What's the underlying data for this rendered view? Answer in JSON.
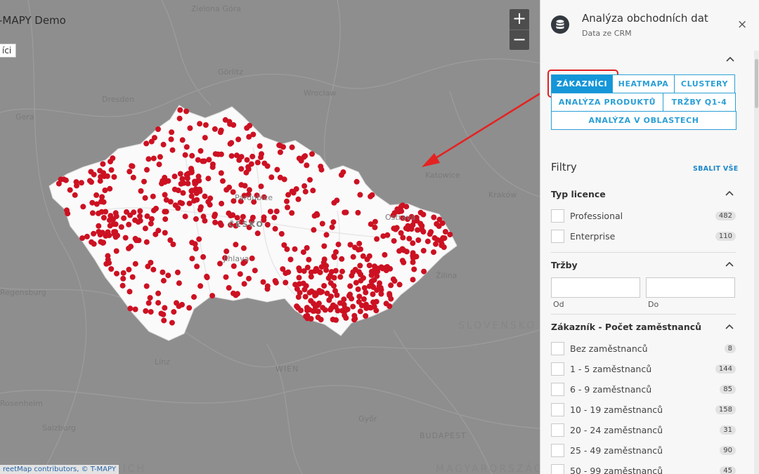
{
  "map": {
    "title": "-MAPY Demo",
    "customers_button": "íci",
    "zoom_in": "+",
    "zoom_out": "−",
    "attribution": "reetMap contributors, © T-MAPY",
    "labels": [
      "Zielona Góra",
      "Dresden",
      "Wrocław",
      "Görlitz",
      "Gera",
      "Katowice",
      "Kraków",
      "Ostrava",
      "Jihlava",
      "ČESKO",
      "Žilina",
      "SLOVENSKO",
      "WIEN",
      "Linz",
      "Salzburg",
      "Győr",
      "BUDAPEST",
      "Rosenheim",
      "MAGYARORSZÁG",
      "REICH",
      "Regensburg",
      "Pardubice"
    ],
    "point_color": "#cc1122"
  },
  "panel": {
    "title": "Analýza obchodních dat",
    "subtitle": "Data ze CRM",
    "close": "×",
    "tabs_row1": [
      "ZÁKAZNÍCI",
      "HEATMAPA",
      "CLUSTERY"
    ],
    "tabs_row2": [
      "ANALÝZA PRODUKTŮ",
      "TRŽBY Q1-4"
    ],
    "tabs_row3": [
      "ANALÝZA V OBLASTECH"
    ],
    "filters_title": "Filtry",
    "collapse_all": "SBALIT VŠE",
    "license": {
      "title": "Typ licence",
      "items": [
        {
          "label": "Professional",
          "count": "482"
        },
        {
          "label": "Enterprise",
          "count": "110"
        }
      ]
    },
    "revenue": {
      "title": "Tržby",
      "from": "Od",
      "to": "Do"
    },
    "employees": {
      "title": "Zákazník - Počet zaměstnanců",
      "items": [
        {
          "label": "Bez zaměstnanců",
          "count": "8"
        },
        {
          "label": "1 - 5 zaměstnanců",
          "count": "144"
        },
        {
          "label": "6 - 9 zaměstnanců",
          "count": "85"
        },
        {
          "label": "10 - 19 zaměstnanců",
          "count": "158"
        },
        {
          "label": "20 - 24 zaměstnanců",
          "count": "31"
        },
        {
          "label": "25 - 49 zaměstnanců",
          "count": "90"
        },
        {
          "label": "50 - 99 zaměstnanců",
          "count": "45"
        }
      ]
    },
    "accent": "#1496d8"
  }
}
